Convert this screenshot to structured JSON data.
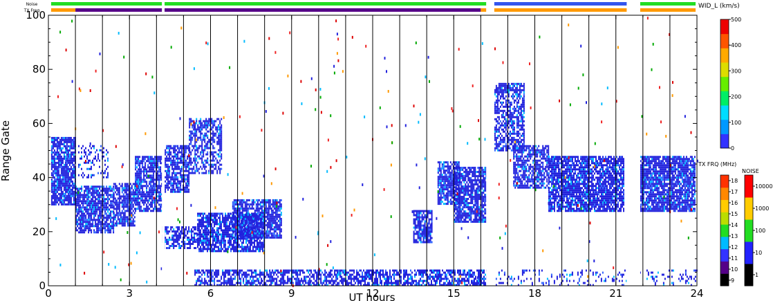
{
  "chart_data": {
    "type": "heatmap",
    "xlabel": "UT hours",
    "ylabel": "Range Gate",
    "xlim": [
      0,
      24
    ],
    "ylim": [
      0,
      100
    ],
    "x_ticks": [
      "0",
      "3",
      "6",
      "9",
      "12",
      "15",
      "18",
      "21",
      "24"
    ],
    "y_ticks": [
      "0",
      "20",
      "40",
      "60",
      "80",
      "100"
    ],
    "status_bars": {
      "noise_label": "Noise",
      "txfreq_label": "TX Freq",
      "noise_segments": [
        {
          "x0": 0.1,
          "x1": 4.2,
          "color": "#22dd22"
        },
        {
          "x0": 4.3,
          "x1": 16.2,
          "color": "#22dd22"
        },
        {
          "x0": 16.5,
          "x1": 21.4,
          "color": "#3355ee"
        },
        {
          "x0": 21.9,
          "x1": 23.95,
          "color": "#22dd22"
        }
      ],
      "txfreq_segments": [
        {
          "x0": 0.1,
          "x1": 1.0,
          "color": "#ff9900"
        },
        {
          "x0": 1.0,
          "x1": 4.2,
          "color": "#550088"
        },
        {
          "x0": 4.3,
          "x1": 16.0,
          "color": "#550088"
        },
        {
          "x0": 16.0,
          "x1": 16.2,
          "color": "#ff9900"
        },
        {
          "x0": 16.5,
          "x1": 21.4,
          "color": "#ff9900"
        },
        {
          "x0": 21.9,
          "x1": 23.95,
          "color": "#ff9900"
        }
      ]
    },
    "hour_markers": [
      1,
      2,
      3,
      4,
      5,
      6,
      7,
      8,
      9,
      10,
      11,
      12,
      13,
      14,
      15,
      16,
      17,
      18,
      19,
      20,
      21,
      22,
      23
    ],
    "data_gaps": [
      [
        4.2,
        4.3
      ],
      [
        16.2,
        16.5
      ],
      [
        21.4,
        21.9
      ]
    ],
    "echo_regions": [
      {
        "x0": 0.1,
        "x1": 1.0,
        "y0": 30,
        "y1": 55,
        "density": 0.85
      },
      {
        "x0": 1.0,
        "x1": 2.4,
        "y0": 20,
        "y1": 37,
        "density": 0.8
      },
      {
        "x0": 2.4,
        "x1": 3.2,
        "y0": 22,
        "y1": 38,
        "density": 0.8
      },
      {
        "x0": 3.2,
        "x1": 4.2,
        "y0": 28,
        "y1": 48,
        "density": 0.8
      },
      {
        "x0": 1.1,
        "x1": 2.2,
        "y0": 40,
        "y1": 52,
        "density": 0.25
      },
      {
        "x0": 4.3,
        "x1": 5.2,
        "y0": 35,
        "y1": 52,
        "density": 0.75
      },
      {
        "x0": 5.2,
        "x1": 6.4,
        "y0": 42,
        "y1": 62,
        "density": 0.55
      },
      {
        "x0": 4.2,
        "x1": 5.5,
        "y0": 14,
        "y1": 22,
        "density": 0.6
      },
      {
        "x0": 5.5,
        "x1": 8.0,
        "y0": 13,
        "y1": 27,
        "density": 0.8
      },
      {
        "x0": 6.8,
        "x1": 8.6,
        "y0": 18,
        "y1": 32,
        "density": 0.8
      },
      {
        "x0": 5.4,
        "x1": 16.2,
        "y0": 0,
        "y1": 6,
        "density": 0.65
      },
      {
        "x0": 13.5,
        "x1": 14.2,
        "y0": 16,
        "y1": 28,
        "density": 0.85
      },
      {
        "x0": 14.4,
        "x1": 15.2,
        "y0": 30,
        "y1": 46,
        "density": 0.8
      },
      {
        "x0": 15.0,
        "x1": 16.2,
        "y0": 24,
        "y1": 44,
        "density": 0.8
      },
      {
        "x0": 16.5,
        "x1": 17.6,
        "y0": 50,
        "y1": 75,
        "density": 0.65
      },
      {
        "x0": 17.2,
        "x1": 18.5,
        "y0": 36,
        "y1": 52,
        "density": 0.7
      },
      {
        "x0": 18.5,
        "x1": 21.3,
        "y0": 28,
        "y1": 48,
        "density": 0.85
      },
      {
        "x0": 21.9,
        "x1": 23.9,
        "y0": 28,
        "y1": 48,
        "density": 0.85
      },
      {
        "x0": 16.5,
        "x1": 24.0,
        "y0": 0,
        "y1": 6,
        "density": 0.15
      }
    ],
    "colorbar_velocity": {
      "title": "WID_L (km/s)",
      "ticks": [
        "0",
        "100",
        "200",
        "300",
        "400",
        "500"
      ],
      "colors": [
        "#3333ff",
        "#0099ff",
        "#00ddff",
        "#00ee66",
        "#66ee00",
        "#dddd00",
        "#ffaa00",
        "#ff5500",
        "#ee0000"
      ]
    },
    "colorbar_txfreq": {
      "title": "TX FRQ (MHz)",
      "ticks": [
        "9",
        "10",
        "11",
        "12",
        "13",
        "14",
        "15",
        "16",
        "17",
        "18"
      ],
      "colors": [
        "#000000",
        "#550088",
        "#3333ff",
        "#00bbff",
        "#22dd22",
        "#bbdd00",
        "#ffcc00",
        "#ff8800",
        "#ff3300"
      ]
    },
    "colorbar_noise": {
      "title": "NOISE",
      "ticks": [
        "1",
        "10",
        "100",
        "1000",
        "10000"
      ],
      "colors": [
        "#000000",
        "#2222ff",
        "#22dd22",
        "#ffcc00",
        "#ff0000"
      ]
    }
  }
}
